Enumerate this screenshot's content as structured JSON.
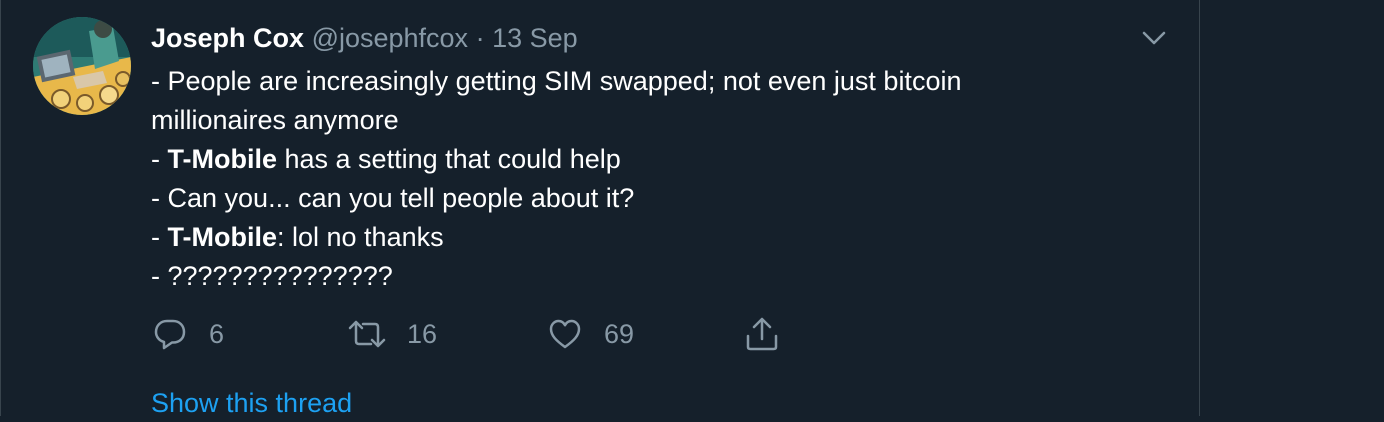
{
  "tweet": {
    "author_name": "Joseph Cox",
    "handle": "@josephfcox",
    "separator": "·",
    "date": "13 Sep",
    "lines": [
      {
        "prefix": "- ",
        "bold": "",
        "text": "People are increasingly getting SIM swapped; not even just bitcoin"
      },
      {
        "prefix": "",
        "bold": "",
        "text": "millionaires anymore"
      },
      {
        "prefix": "- ",
        "bold": "T-Mobile",
        "text": " has a setting that could help"
      },
      {
        "prefix": "- ",
        "bold": "",
        "text": "Can you... can you tell people about it?"
      },
      {
        "prefix": "- ",
        "bold": "T-Mobile",
        "text": ": lol no thanks"
      },
      {
        "prefix": "- ",
        "bold": "",
        "text": "???????????????"
      }
    ],
    "actions": {
      "reply_count": "6",
      "retweet_count": "16",
      "like_count": "69"
    },
    "show_thread_label": "Show this thread"
  },
  "colors": {
    "background": "#15202b",
    "muted": "#8899a6",
    "link": "#1da1f2",
    "divider": "#38444d"
  },
  "icons": [
    "chevron-down-icon",
    "reply-icon",
    "retweet-icon",
    "like-icon",
    "share-icon"
  ]
}
